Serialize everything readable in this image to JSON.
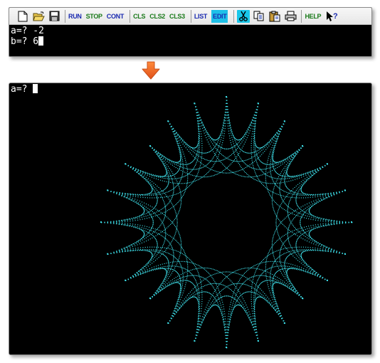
{
  "toolbar": {
    "buttons": [
      {
        "name": "new-file-icon"
      },
      {
        "name": "open-folder-icon"
      },
      {
        "name": "save-disk-icon"
      },
      {
        "name": "separator"
      },
      {
        "name": "run-button",
        "label": "RUN"
      },
      {
        "name": "stop-button",
        "label": "STOP"
      },
      {
        "name": "cont-button",
        "label": "CONT"
      },
      {
        "name": "separator"
      },
      {
        "name": "cls-button",
        "label": "CLS"
      },
      {
        "name": "cls2-button",
        "label": "CLS2"
      },
      {
        "name": "cls3-button",
        "label": "CLS3"
      },
      {
        "name": "separator"
      },
      {
        "name": "list-button",
        "label": "LIST"
      },
      {
        "name": "edit-button",
        "label": "EDIT"
      },
      {
        "name": "separator"
      },
      {
        "name": "cut-scissors-icon"
      },
      {
        "name": "copy-icon"
      },
      {
        "name": "paste-icon"
      },
      {
        "name": "print-printer-icon"
      },
      {
        "name": "separator"
      },
      {
        "name": "help-button",
        "label": "HELP"
      },
      {
        "name": "context-help-icon"
      }
    ],
    "run_label": "RUN",
    "stop_label": "STOP",
    "cont_label": "CONT",
    "cls_label": "CLS",
    "cls2_label": "CLS2",
    "cls3_label": "CLS3",
    "list_label": "LIST",
    "edit_label": "EDIT",
    "help_label": "HELP"
  },
  "console": {
    "line1": "a=? -2",
    "line2": "b=? 6"
  },
  "graphics": {
    "prompt": "a=? ",
    "plot_color": "#3ee0ea",
    "plot_params": {
      "a": -2,
      "b": 6
    }
  },
  "colors": {
    "toolbar_green_text": "#1a7a1a",
    "toolbar_blue_text": "#1a2ab0",
    "edit_highlight": "#1ec0e8",
    "arrow": "#f06a1e",
    "console_bg": "#000000",
    "console_text": "#ffffff"
  }
}
